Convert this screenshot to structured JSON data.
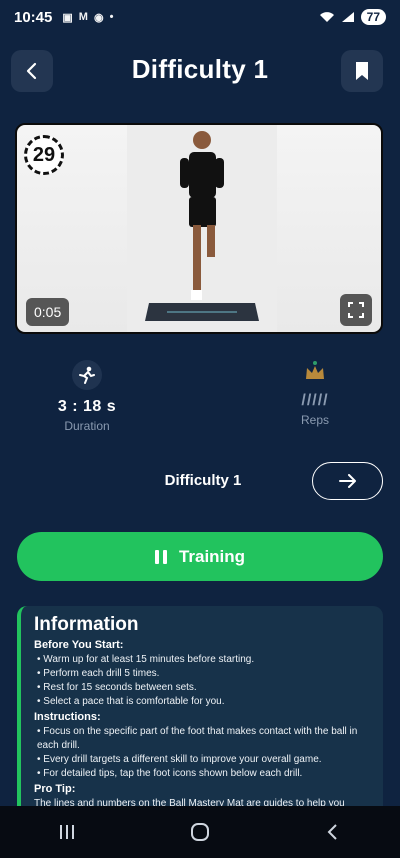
{
  "status_bar": {
    "time": "10:45",
    "notifications": [
      "screenshot-icon",
      "gmail-icon",
      "wechat-icon",
      "dot"
    ],
    "battery": "77"
  },
  "header": {
    "title": "Difficulty 1",
    "back_icon": "chevron-left-icon",
    "bookmark_icon": "bookmark-icon"
  },
  "video": {
    "countdown": "29",
    "elapsed": "0:05",
    "fullscreen_icon": "fullscreen-icon"
  },
  "stats": {
    "duration_value": "3 : 18 s",
    "duration_label": "Duration",
    "reps_bars": "/////",
    "reps_label": "Reps"
  },
  "difficulty": {
    "label": "Difficulty 1",
    "next_icon": "arrow-right-icon"
  },
  "training_button": {
    "label": "Training"
  },
  "info": {
    "title": "Information",
    "before_title": "Before You Start:",
    "before_items": [
      "Warm up for at least 15 minutes before starting.",
      "Perform each drill 5 times.",
      "Rest for 15 seconds between sets.",
      "Select a pace that is comfortable for you."
    ],
    "instructions_title": "Instructions:",
    "instructions_items": [
      "Focus on the specific part of the foot that makes contact with the ball in each drill.",
      "Every drill targets a different skill to improve your overall game.",
      "For detailed tips, tap the foot icons shown below each drill."
    ],
    "pro_tip_title": "Pro Tip:",
    "pro_tip_text": "The lines and numbers on the Ball Mastery Mat are guides to help you"
  },
  "colors": {
    "background": "#0f2340",
    "accent": "#22c35e",
    "card": "#17324a"
  }
}
